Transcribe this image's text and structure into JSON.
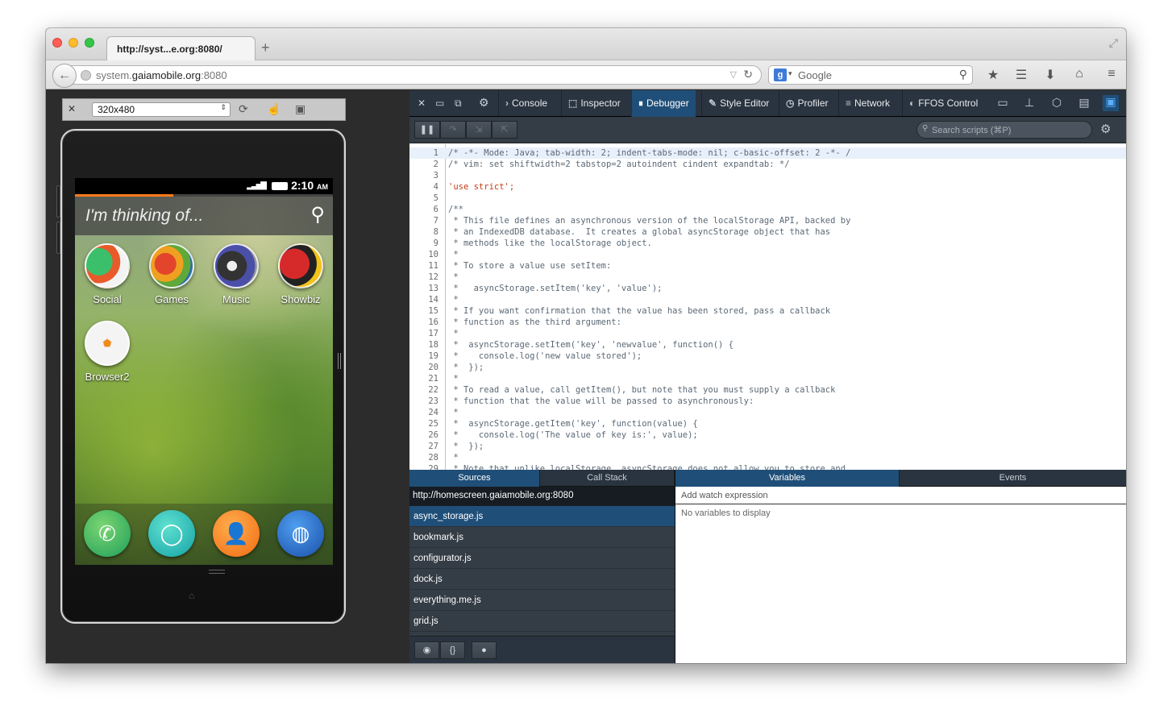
{
  "browser": {
    "tab_title": "http://syst...e.org:8080/",
    "new_tab": "+",
    "url_prefix": "system.",
    "url_domain": "gaiamobile.org",
    "url_suffix": ":8080",
    "search_placeholder": "Google"
  },
  "simulator": {
    "screen_size": "320x480",
    "status_time": "2:10",
    "status_ampm": "AM",
    "search_prompt": "I'm thinking of...",
    "load_progress": 0.38,
    "apps": [
      "Social",
      "Games",
      "Music",
      "Showbiz",
      "Browser2"
    ],
    "dock": [
      "phone",
      "messages",
      "contacts",
      "browser"
    ]
  },
  "devtools": {
    "tabs": [
      "Console",
      "Inspector",
      "Debugger",
      "Style Editor",
      "Profiler",
      "Network",
      "FFOS Control"
    ],
    "active_tab": "Debugger",
    "search_scripts": "Search scripts (⌘P)",
    "code_lines": [
      "/* -*- Mode: Java; tab-width: 2; indent-tabs-mode: nil; c-basic-offset: 2 -*- /",
      "/* vim: set shiftwidth=2 tabstop=2 autoindent cindent expandtab: */",
      "",
      "'use strict';",
      "",
      "/**",
      " * This file defines an asynchronous version of the localStorage API, backed by",
      " * an IndexedDB database.  It creates a global asyncStorage object that has",
      " * methods like the localStorage object.",
      " *",
      " * To store a value use setItem:",
      " *",
      " *   asyncStorage.setItem('key', 'value');",
      " *",
      " * If you want confirmation that the value has been stored, pass a callback",
      " * function as the third argument:",
      " *",
      " *  asyncStorage.setItem('key', 'newvalue', function() {",
      " *    console.log('new value stored');",
      " *  });",
      " *",
      " * To read a value, call getItem(), but note that you must supply a callback",
      " * function that the value will be passed to asynchronously:",
      " *",
      " *  asyncStorage.getItem('key', function(value) {",
      " *    console.log('The value of key is:', value);",
      " *  });",
      " *",
      " * Note that unlike localStorage, asyncStorage does not allow you to store and"
    ],
    "left_tabs": [
      "Sources",
      "Call Stack"
    ],
    "right_tabs": [
      "Variables",
      "Events"
    ],
    "source_group": "http://homescreen.gaiamobile.org:8080",
    "sources": [
      "async_storage.js",
      "bookmark.js",
      "configurator.js",
      "dock.js",
      "everything.me.js",
      "grid.js"
    ],
    "active_source": "async_storage.js",
    "watch_placeholder": "Add watch expression",
    "no_vars": "No variables to display",
    "pretty_print": "{}"
  }
}
